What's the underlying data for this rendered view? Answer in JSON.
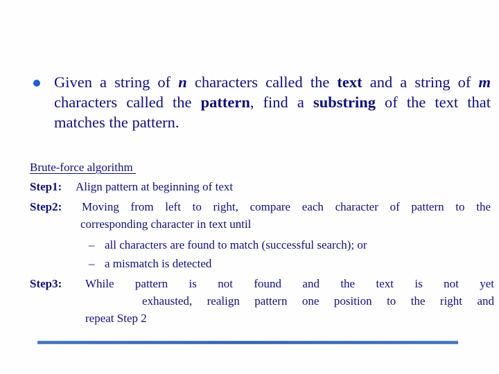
{
  "slide": {
    "accent_color": "#1f5fc8",
    "text_color": "#0f0f78",
    "bullet": {
      "icon": "bullet-dot-icon",
      "parts": [
        {
          "t": "Given a string of ",
          "style": "normal"
        },
        {
          "t": "n",
          "style": "var"
        },
        {
          "t": " characters called the ",
          "style": "normal"
        },
        {
          "t": "text",
          "style": "bold"
        },
        {
          "t": " and a string of ",
          "style": "normal"
        },
        {
          "t": "m",
          "style": "var"
        },
        {
          "t": " characters called the ",
          "style": "normal"
        },
        {
          "t": "pattern",
          "style": "bold"
        },
        {
          "t": ", find a ",
          "style": "normal"
        },
        {
          "t": "substring",
          "style": "bold"
        },
        {
          "t": " of the text that matches the pattern.",
          "style": "normal"
        }
      ]
    },
    "algorithm": {
      "heading": "Brute-force algorithm ",
      "step1": {
        "label": "Step1:",
        "text": "Align pattern at beginning of text"
      },
      "step2": {
        "label": "Step2:",
        "line1": "Moving from left to right, compare each character of pattern to the",
        "line2": "corresponding character in text until",
        "subitems": [
          {
            "dash": "–",
            "text": "all characters are found to match (successful search); or"
          },
          {
            "dash": "–",
            "text": "a mismatch is detected"
          }
        ]
      },
      "step3": {
        "label": "Step3:",
        "line1": "While pattern is not found and the text is not yet",
        "line2": "exhausted, realign pattern one position to the right and",
        "line3": "repeat Step 2"
      }
    }
  }
}
